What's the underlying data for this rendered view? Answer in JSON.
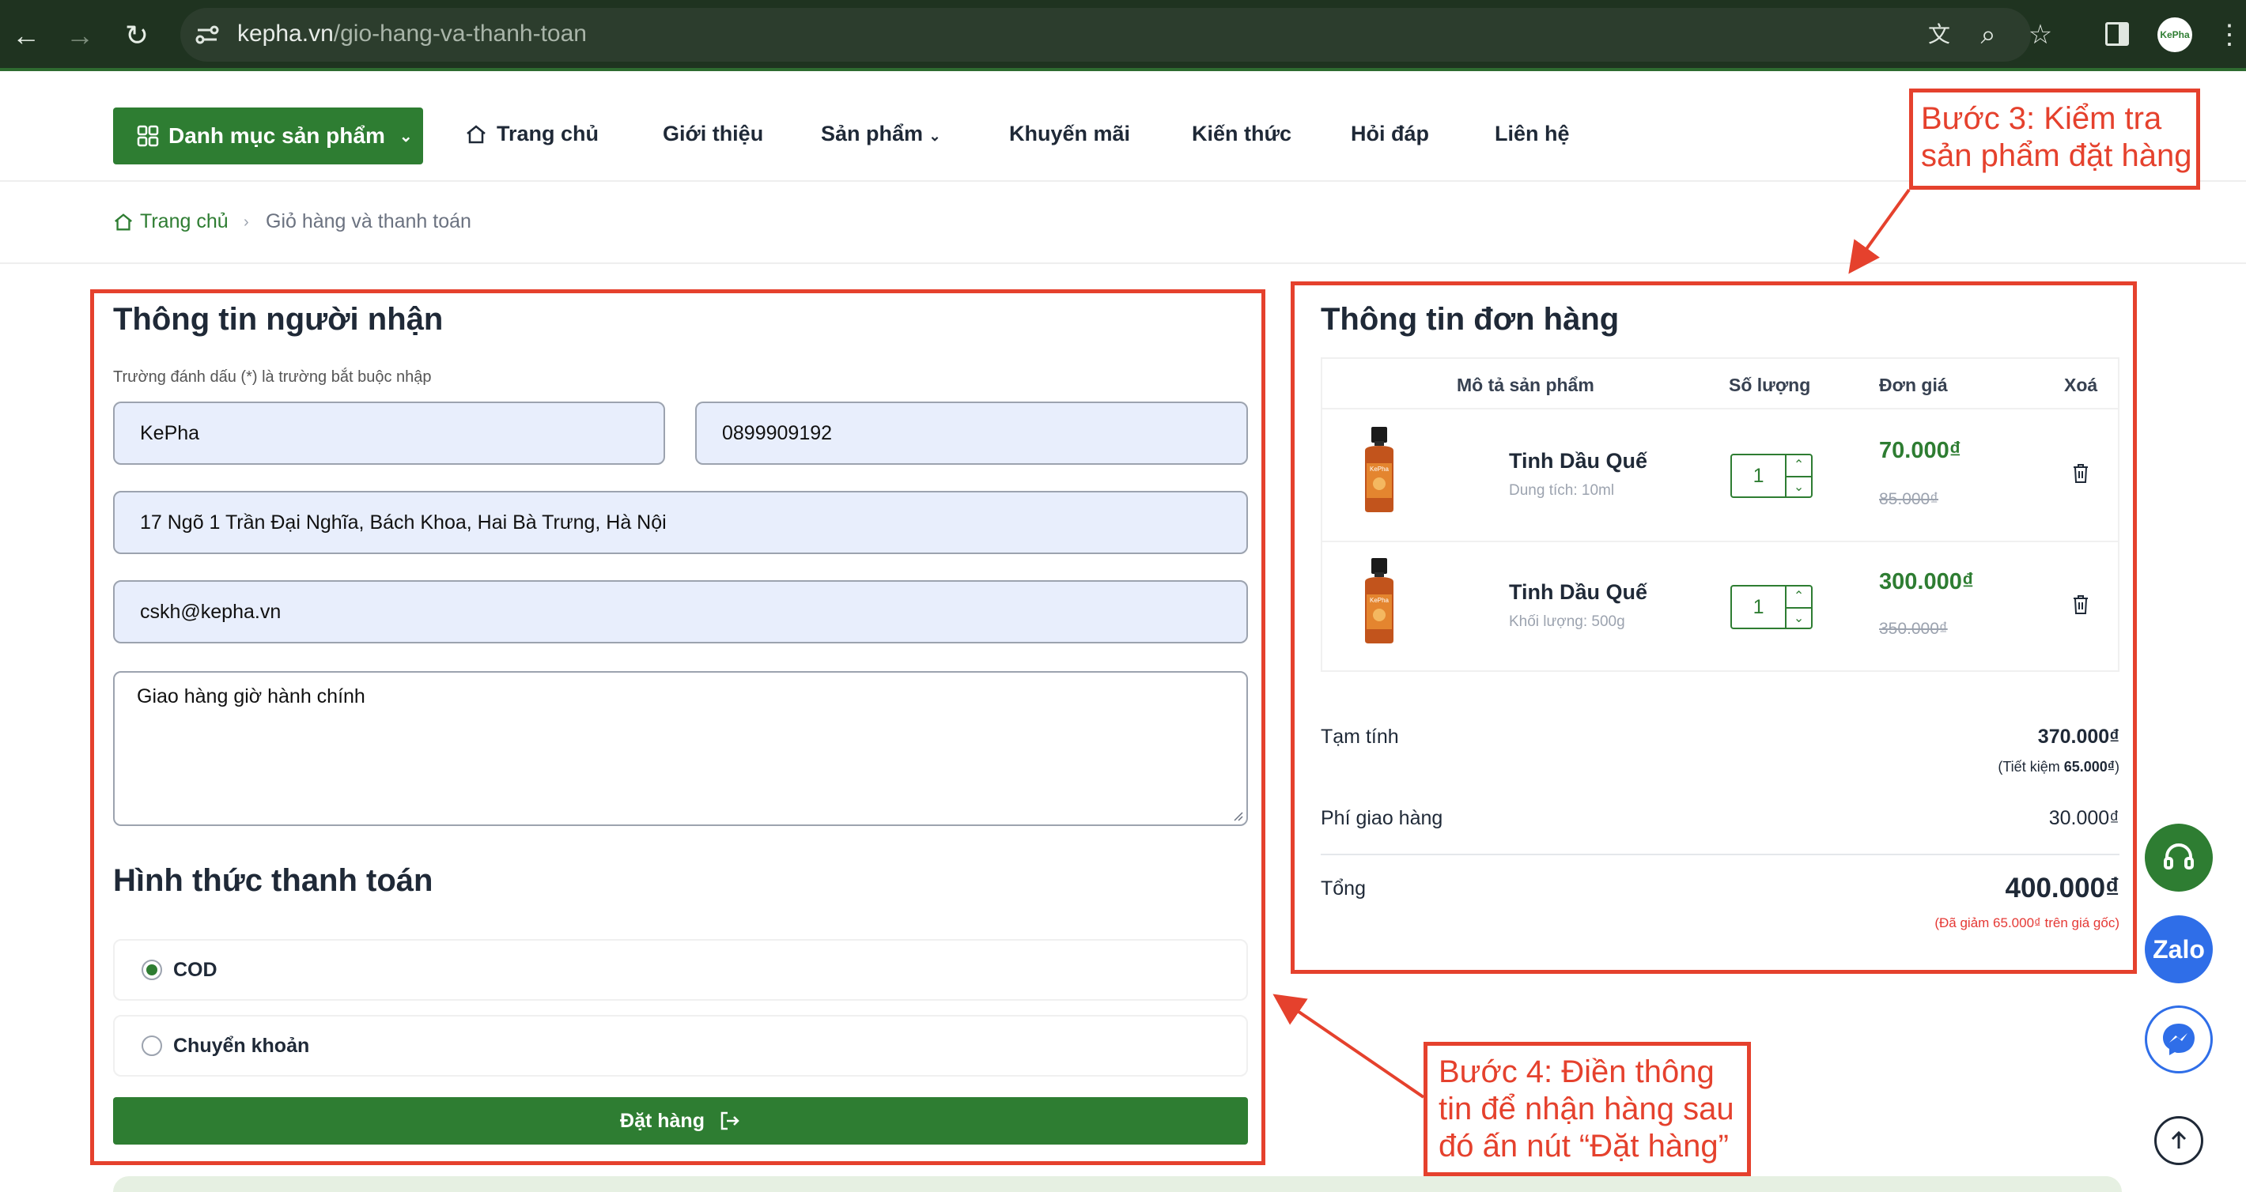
{
  "browser": {
    "url_host": "kepha.vn",
    "url_path": "/gio-hang-va-thanh-toan",
    "avatar_text": "KePha"
  },
  "header": {
    "category_button": "Danh mục sản phẩm",
    "nav": [
      "Trang chủ",
      "Giới thiệu",
      "Sản phẩm",
      "Khuyến mãi",
      "Kiến thức",
      "Hỏi đáp",
      "Liên hệ"
    ]
  },
  "breadcrumb": {
    "home": "Trang chủ",
    "separator": "›",
    "current": "Giỏ hàng và thanh toán"
  },
  "recipient": {
    "title": "Thông tin người nhận",
    "hint": "Trường đánh dấu (*) là trường bắt buộc nhập",
    "name": "KePha",
    "phone": "0899909192",
    "address": "17 Ngõ 1 Trần Đại Nghĩa, Bách Khoa, Hai Bà Trưng, Hà Nội",
    "email": "cskh@kepha.vn",
    "note": "Giao hàng giờ hành chính"
  },
  "payment": {
    "title": "Hình thức thanh toán",
    "options": [
      {
        "label": "COD",
        "selected": true
      },
      {
        "label": "Chuyển khoản",
        "selected": false
      }
    ],
    "order_button": "Đặt hàng"
  },
  "order": {
    "title": "Thông tin đơn hàng",
    "columns": [
      "Mô tả sản phẩm",
      "Số lượng",
      "Đơn giá",
      "Xoá"
    ],
    "items": [
      {
        "name": "Tinh Dầu Quế",
        "variant": "Dung tích: 10ml",
        "qty": "1",
        "price": "70.000₫",
        "old_price": "85.000₫",
        "bottle_label": "KePha"
      },
      {
        "name": "Tinh Dầu Quế",
        "variant": "Khối lượng: 500g",
        "qty": "1",
        "price": "300.000₫",
        "old_price": "350.000₫",
        "bottle_label": "KePha"
      }
    ],
    "subtotal_label": "Tạm tính",
    "subtotal": "370.000₫",
    "savings_prefix": "(Tiết kiệm ",
    "savings": "65.000₫",
    "savings_suffix": ")",
    "shipping_label": "Phí giao hàng",
    "shipping": "30.000₫",
    "total_label": "Tổng",
    "total": "400.000₫",
    "discount_note": "(Đã giảm 65.000₫ trên giá gốc)"
  },
  "annotations": {
    "step3": "Bước 3: Kiểm tra sản phẩm đặt hàng",
    "step4": "Bước 4: Điền thông tin để nhận hàng sau đó ấn nút “Đặt hàng”"
  },
  "floating": {
    "zalo": "Zalo"
  },
  "colors": {
    "brand_green": "#2e7d32",
    "annotation_red": "#e5412d",
    "input_bg": "#e8eefc",
    "zalo_blue": "#2f6ee8"
  }
}
